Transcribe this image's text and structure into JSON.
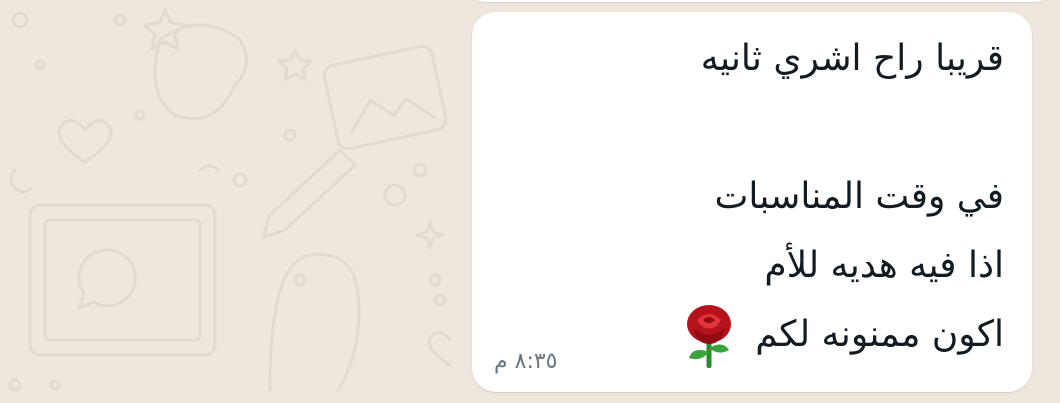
{
  "chat": {
    "message": {
      "line1": "قريبا راح اشري ثانيه",
      "line2": "في وقت المناسبات",
      "line3": "اذا فيه هديه للأم",
      "line4": "اكون ممنونه لكم",
      "emoji_icon": "rose-emoji-icon",
      "time": "٨:٣٥ م"
    }
  },
  "colors": {
    "wallpaper": "#efe7de",
    "bubble": "#ffffff",
    "text": "#111b21",
    "timestamp": "#667781",
    "rose": "#c4161c",
    "stem": "#2e8b2e"
  }
}
